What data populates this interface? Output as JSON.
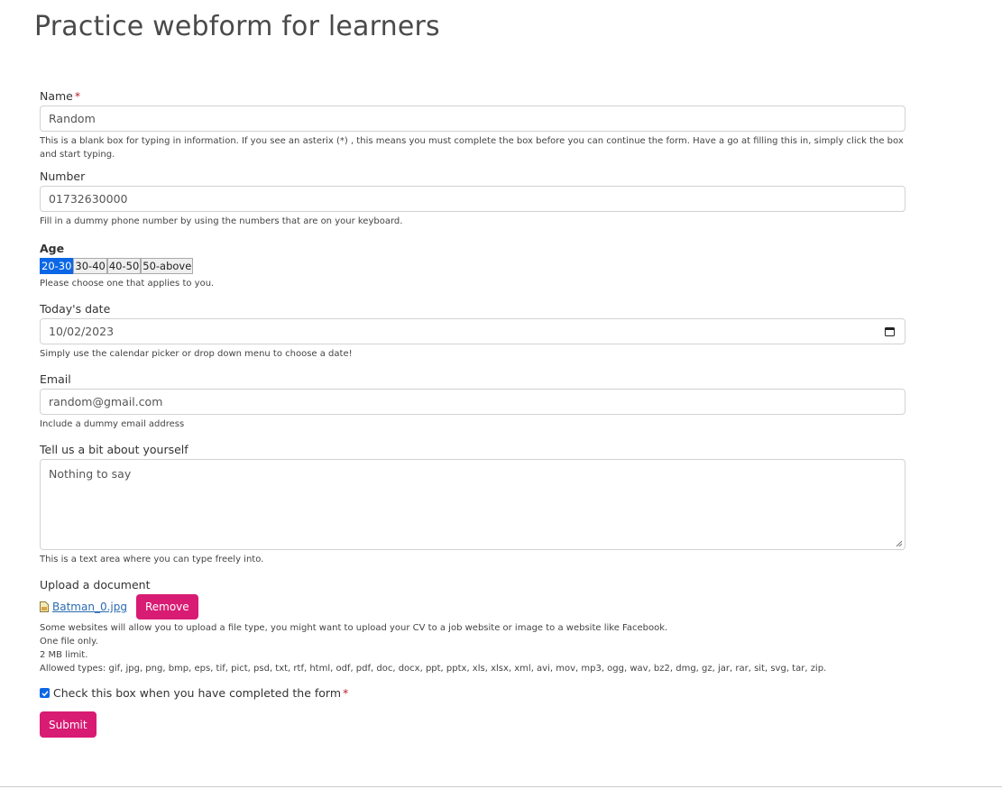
{
  "page": {
    "title": "Practice webform for learners"
  },
  "form": {
    "name": {
      "label": "Name",
      "required_mark": "*",
      "value": "Random",
      "help": "This is a blank box for typing in information. If you see an asterix (*) , this means you must complete the box before you can continue the form. Have a go at filling this in, simply click the box and start typing."
    },
    "number": {
      "label": "Number",
      "value": "01732630000",
      "help": "Fill in a dummy phone number by using the numbers that are on your keyboard."
    },
    "age": {
      "label": "Age",
      "options": [
        "20-30",
        "30-40",
        "40-50",
        "50-above"
      ],
      "selected": "20-30",
      "help": "Please choose one that applies to you."
    },
    "date": {
      "label": "Today's date",
      "value": "10/02/2023",
      "icon": "calendar-icon",
      "help": "Simply use the calendar picker or drop down menu to choose a date!"
    },
    "email": {
      "label": "Email",
      "value": "random@gmail.com",
      "help": "Include a dummy email address"
    },
    "about": {
      "label": "Tell us a bit about yourself",
      "value": "Nothing to say",
      "help": "This is a text area where you can type freely into."
    },
    "upload": {
      "label": "Upload a document",
      "file_name": "Batman_0.jpg",
      "file_icon": "image-file-icon",
      "remove_label": "Remove",
      "help_lines": [
        "Some websites will allow you to upload a file type, you might want to upload your CV to a job website or image to a website like Facebook.",
        "One file only.",
        "2 MB limit.",
        "Allowed types: gif, jpg, png, bmp, eps, tif, pict, psd, txt, rtf, html, odf, pdf, doc, docx, ppt, pptx, xls, xlsx, xml, avi, mov, mp3, ogg, wav, bz2, dmg, gz, jar, rar, sit, svg, tar, zip."
      ]
    },
    "complete": {
      "label": "Check this box when you have completed the form",
      "required_mark": "*",
      "checked": true
    },
    "submit_label": "Submit"
  },
  "colors": {
    "accent": "#d81b73",
    "selected": "#0b67e6",
    "required": "#c0202e"
  }
}
